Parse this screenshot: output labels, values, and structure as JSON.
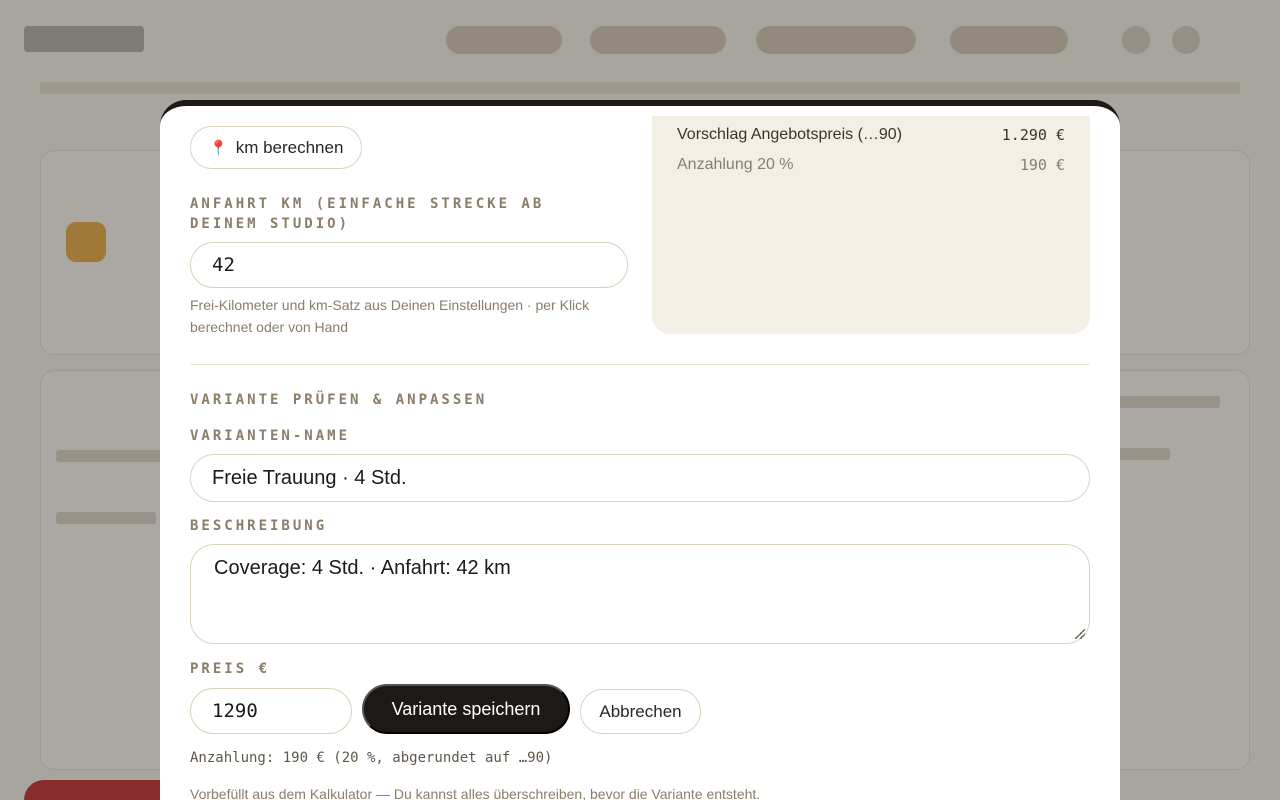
{
  "calculator": {
    "km_button_label": "km berechnen",
    "distance_label": "ANFAHRT KM (EINFACHE STRECKE AB DEINEM STUDIO)",
    "distance_value": "42",
    "distance_hint": "Frei-Kilometer und km-Satz aus Deinen Einstellungen · per Klick berechnet oder von Hand",
    "summary": [
      {
        "label": "Vorschlag Angebotspreis (…90)",
        "value": "1.290 €"
      },
      {
        "label": "Anzahlung 20 %",
        "value": "190 €"
      }
    ]
  },
  "variant": {
    "section_title": "VARIANTE PRÜFEN & ANPASSEN",
    "name_label": "VARIANTEN-NAME",
    "name_value": "Freie Trauung · 4 Std.",
    "description_label": "BESCHREIBUNG",
    "description_value": "Coverage: 4 Std. · Anfahrt: 42 km",
    "price_label": "PREIS €",
    "price_value": "1290",
    "save_label": "Variante speichern",
    "cancel_label": "Abbrechen",
    "deposit_text": "Anzahlung: 190 € (20 %, abgerundet auf …90)",
    "footnote": "Vorbefüllt aus dem Kalkulator — Du kannst alles überschreiben, bevor die Variante entsteht."
  },
  "icons": {
    "km_button_icon": "map-pin-icon"
  },
  "colors": {
    "primary_button": "#1c1916",
    "accent_pin": "#d23a3a",
    "summary_bg": "#f4efe4"
  }
}
